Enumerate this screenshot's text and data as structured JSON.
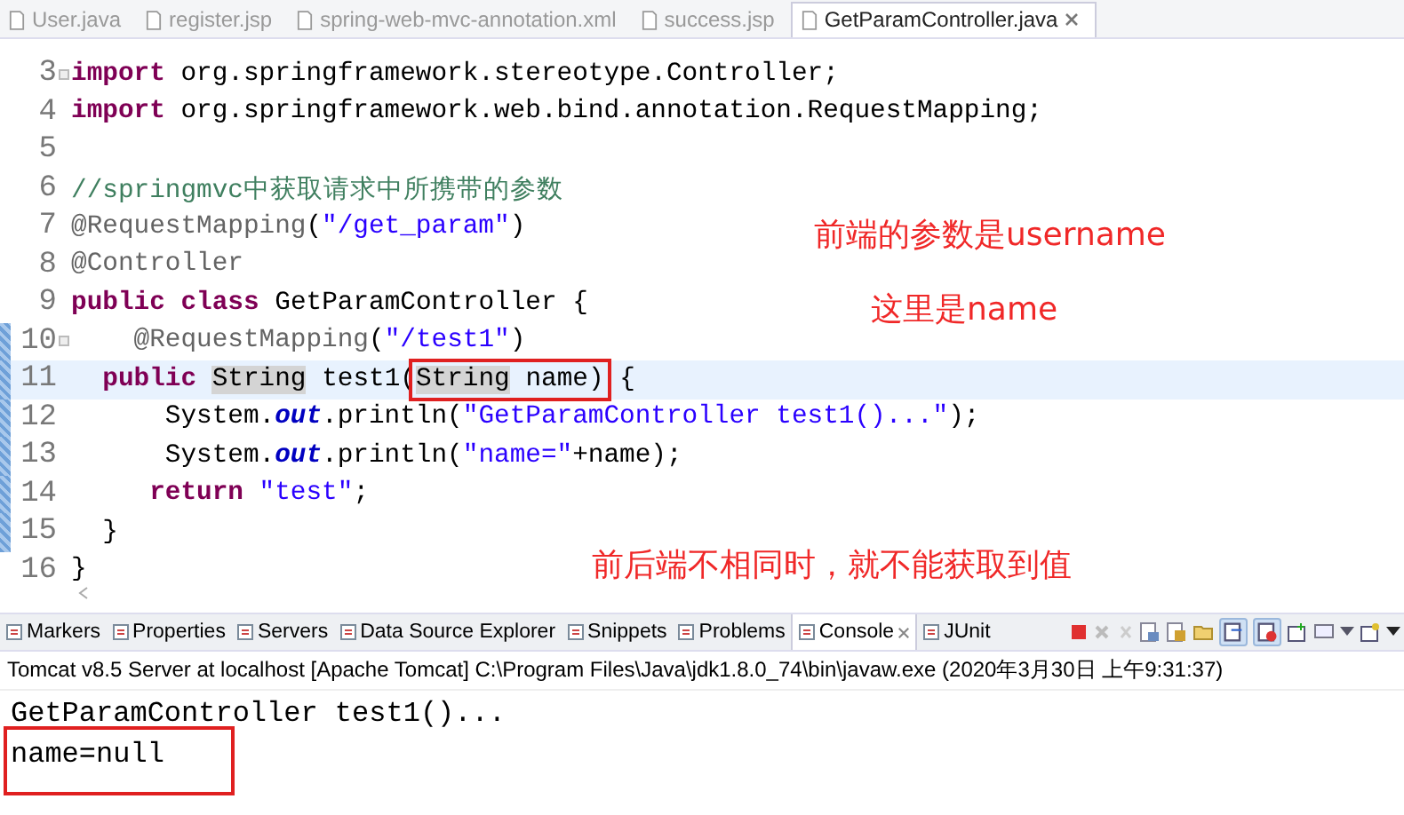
{
  "editor_tabs": [
    {
      "label": "User.java",
      "selected": false
    },
    {
      "label": "register.jsp",
      "selected": false
    },
    {
      "label": "spring-web-mvc-annotation.xml",
      "selected": false
    },
    {
      "label": "success.jsp",
      "selected": false
    },
    {
      "label": "GetParamController.java",
      "selected": true
    }
  ],
  "code_lines": [
    {
      "number": "3",
      "fold": true,
      "changed": false,
      "current": false,
      "segments": [
        {
          "kind": "keyword",
          "text": "import"
        },
        {
          "kind": "plain",
          "text": " org.springframework.stereotype.Controller;"
        }
      ]
    },
    {
      "number": "4",
      "fold": false,
      "changed": false,
      "current": false,
      "segments": [
        {
          "kind": "keyword",
          "text": "import"
        },
        {
          "kind": "plain",
          "text": " org.springframework.web.bind.annotation.RequestMapping;"
        }
      ]
    },
    {
      "number": "5",
      "fold": false,
      "changed": false,
      "current": false
    },
    {
      "number": "6",
      "fold": false,
      "changed": false,
      "current": false,
      "segments": [
        {
          "kind": "comment",
          "text": "//springmvc中获取请求中所携带的参数"
        }
      ]
    },
    {
      "number": "7",
      "fold": false,
      "changed": false,
      "current": false,
      "segments": [
        {
          "kind": "annotation",
          "text": "@RequestMapping"
        },
        {
          "kind": "plain",
          "text": "("
        },
        {
          "kind": "string",
          "text": "\"/get_param\""
        },
        {
          "kind": "plain",
          "text": ")"
        }
      ]
    },
    {
      "number": "8",
      "fold": false,
      "changed": false,
      "current": false,
      "segments": [
        {
          "kind": "annotation",
          "text": "@Controller"
        }
      ]
    },
    {
      "number": "9",
      "fold": false,
      "changed": false,
      "current": false,
      "segments": [
        {
          "kind": "keyword",
          "text": "public"
        },
        {
          "kind": "keyword",
          "text": " class"
        },
        {
          "kind": "plain",
          "text": " GetParamController {"
        }
      ]
    },
    {
      "number": "10",
      "fold": true,
      "changed": true,
      "current": false,
      "segments": [
        {
          "kind": "annotation",
          "text": "    @RequestMapping"
        },
        {
          "kind": "plain",
          "text": "("
        },
        {
          "kind": "string",
          "text": "\"/test1\""
        },
        {
          "kind": "plain",
          "text": ")"
        }
      ]
    },
    {
      "number": "11",
      "fold": false,
      "changed": true,
      "current": true,
      "segments": [
        {
          "kind": "keyword",
          "text": "  public"
        },
        {
          "kind": "occurrence",
          "text": " String"
        },
        {
          "kind": "plain",
          "text": " test1("
        },
        {
          "kind": "box",
          "segments": [
            {
              "kind": "occurrence",
              "text": "String"
            },
            {
              "kind": "plain",
              "text": " name)"
            }
          ]
        },
        {
          "kind": "plain",
          "text": " {"
        }
      ]
    },
    {
      "number": "12",
      "fold": false,
      "changed": true,
      "current": false,
      "segments": [
        {
          "kind": "plain",
          "text": "      System."
        },
        {
          "kind": "static",
          "text": "out"
        },
        {
          "kind": "plain",
          "text": ".println("
        },
        {
          "kind": "string",
          "text": "\"GetParamController test1()...\""
        },
        {
          "kind": "plain",
          "text": ");"
        }
      ]
    },
    {
      "number": "13",
      "fold": false,
      "changed": true,
      "current": false,
      "segments": [
        {
          "kind": "plain",
          "text": "      System."
        },
        {
          "kind": "static",
          "text": "out"
        },
        {
          "kind": "plain",
          "text": ".println("
        },
        {
          "kind": "string",
          "text": "\"name=\""
        },
        {
          "kind": "plain",
          "text": "+name);"
        }
      ]
    },
    {
      "number": "14",
      "fold": false,
      "changed": true,
      "current": false,
      "segments": [
        {
          "kind": "keyword",
          "text": "     return"
        },
        {
          "kind": "string",
          "text": " \"test\""
        },
        {
          "kind": "plain",
          "text": ";"
        }
      ]
    },
    {
      "number": "15",
      "fold": false,
      "changed": true,
      "current": false,
      "segments": [
        {
          "kind": "plain",
          "text": "  }"
        }
      ]
    },
    {
      "number": "16",
      "fold": false,
      "changed": false,
      "current": false,
      "segments": [
        {
          "kind": "plain",
          "text": "}"
        }
      ]
    }
  ],
  "notes": [
    "前端的参数是username",
    "这里是name",
    "前后端不相同时，就不能获取到值"
  ],
  "panel_tabs": [
    {
      "label": "Markers",
      "selected": false
    },
    {
      "label": "Properties",
      "selected": false
    },
    {
      "label": "Servers",
      "selected": false
    },
    {
      "label": "Data Source Explorer",
      "selected": false
    },
    {
      "label": "Snippets",
      "selected": false
    },
    {
      "label": "Problems",
      "selected": false
    },
    {
      "label": "Console",
      "selected": true
    },
    {
      "label": "JUnit",
      "selected": false
    }
  ],
  "console": {
    "header": "Tomcat v8.5 Server at localhost [Apache Tomcat] C:\\Program Files\\Java\\jdk1.8.0_74\\bin\\javaw.exe (2020年3月30日 上午9:31:37)",
    "lines": [
      {
        "text": "GetParamController test1()...",
        "boxed": false
      },
      {
        "text": "name=null",
        "boxed": true
      }
    ]
  }
}
